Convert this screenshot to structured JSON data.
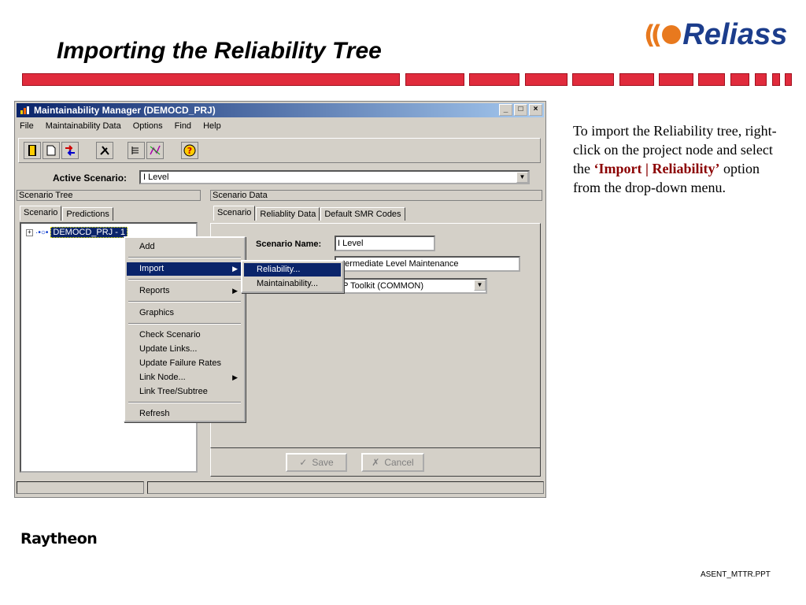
{
  "slide": {
    "title": "Importing the Reliability Tree",
    "logo_text": "Reliass",
    "footer_company": "Raytheon",
    "footer_file": "ASENT_MTTR.PPT",
    "colors": {
      "bar_red": "#e02b3c",
      "logo_orange": "#e8791e",
      "logo_blue": "#1c3d8c",
      "titlebar_blue": "#0a246a"
    }
  },
  "description": {
    "text_before": "To import the Reliability tree, right-click on the project node and select the ",
    "highlight": "‘Import | Reliability’",
    "text_after": " option from the drop-down menu."
  },
  "window": {
    "title": "Maintainability Manager (DEMOCD_PRJ)",
    "controls": {
      "minimize": "_",
      "maximize": "□",
      "close": "×"
    },
    "menu": [
      "File",
      "Maintainability Data",
      "Options",
      "Find",
      "Help"
    ],
    "toolbar_icons": [
      "exit-icon",
      "new-icon",
      "import-icon",
      "tools-icon",
      "list-icon",
      "chart-icon",
      "help-icon"
    ],
    "active_scenario": {
      "label": "Active Scenario:",
      "value": "I Level"
    },
    "scenario_tree": {
      "header": "Scenario Tree",
      "tabs": [
        "Scenario",
        "Predictions"
      ],
      "node_label": "DEMOCD_PRJ - 1"
    },
    "scenario_data": {
      "header": "Scenario Data",
      "tabs": [
        "Scenario",
        "Reliablity Data",
        "Default SMR Codes"
      ],
      "name_label": "Scenario Name:",
      "name_value": "I Level",
      "description_value": "ntermediate Level Maintenance",
      "toolkit_value": "7P Toolkit (COMMON)"
    },
    "buttons": {
      "save": "Save",
      "cancel": "Cancel"
    },
    "context_menu": [
      {
        "label": "Add"
      },
      {
        "label": "Import",
        "submenu": true,
        "selected": true
      },
      {
        "label": "Reports",
        "submenu": true
      },
      {
        "label": "Graphics"
      },
      {
        "label": "Check Scenario"
      },
      {
        "label": "Update Links..."
      },
      {
        "label": "Update Failure Rates"
      },
      {
        "label": "Link Node...",
        "submenu": true
      },
      {
        "label": "Link Tree/Subtree"
      },
      {
        "label": "Refresh"
      }
    ],
    "submenu": [
      {
        "label": "Reliability...",
        "selected": true
      },
      {
        "label": "Maintainability..."
      }
    ]
  }
}
